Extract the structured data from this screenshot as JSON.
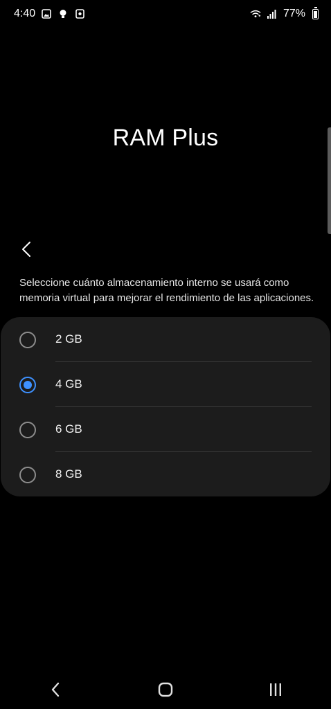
{
  "status_bar": {
    "time": "4:40",
    "battery_percent": "77%",
    "battery_level": 0.77,
    "left_icons": [
      "gallery-icon",
      "lightbulb-icon",
      "screenshot-icon"
    ],
    "right_icons": [
      "wifi-calling-icon",
      "signal-icon",
      "battery-icon"
    ]
  },
  "page": {
    "title": "RAM Plus",
    "description": "Seleccione cuánto almacenamiento interno se usará como memoria virtual para mejorar el rendimiento de las aplicaciones."
  },
  "options": [
    {
      "label": "2 GB",
      "selected": false
    },
    {
      "label": "4 GB",
      "selected": true
    },
    {
      "label": "6 GB",
      "selected": false
    },
    {
      "label": "8 GB",
      "selected": false
    }
  ],
  "colors": {
    "accent": "#3e91ff",
    "background": "#000000",
    "card": "#1c1c1c"
  },
  "nav_bar": {
    "buttons": [
      "back-icon",
      "home-icon",
      "recents-icon"
    ]
  }
}
